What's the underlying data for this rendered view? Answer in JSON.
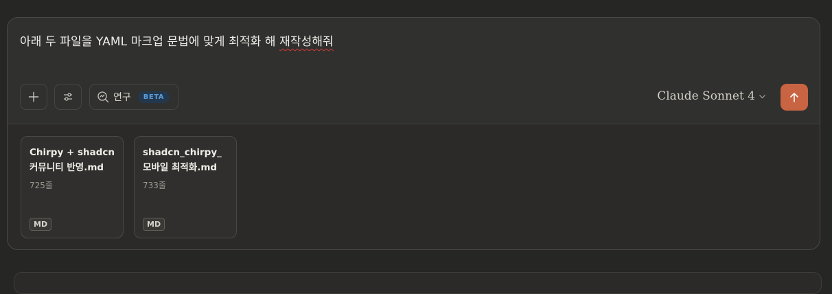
{
  "composer": {
    "prompt_prefix": "아래 두 파일을 YAML 마크업 문법에 맞게 최적화 해 ",
    "prompt_misspelled": "재작성해줘",
    "toolbar": {
      "plus_icon": "plus-icon",
      "settings_icon": "sliders-icon",
      "research_icon": "research-icon",
      "research_label": "연구",
      "beta_label": "BETA"
    },
    "model_name": "Claude Sonnet 4",
    "send_icon": "arrow-up-icon",
    "accent_color": "#c96442"
  },
  "attachments": [
    {
      "name": "Chirpy + shadcn 커뮤니티 반영.md",
      "lines": "725줄",
      "type": "MD"
    },
    {
      "name": "shadcn_chirpy_모바일 최적화.md",
      "lines": "733줄",
      "type": "MD"
    }
  ]
}
